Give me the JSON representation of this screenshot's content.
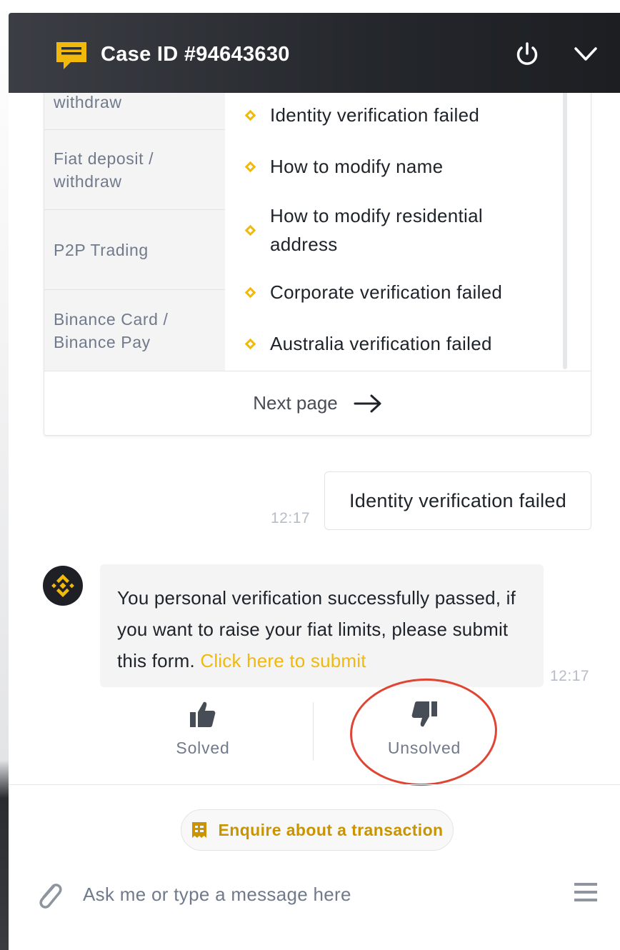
{
  "header": {
    "title": "Case ID #94643630",
    "icons": [
      "chat-icon",
      "power-icon",
      "chevron-down-icon"
    ]
  },
  "categories": [
    {
      "label": "withdraw"
    },
    {
      "label": "Fiat deposit / withdraw"
    },
    {
      "label": "P2P Trading"
    },
    {
      "label": "Binance Card / Binance Pay"
    }
  ],
  "questions": [
    {
      "label": "Identity verification failed"
    },
    {
      "label": "How to modify name"
    },
    {
      "label": "How to modify residential address"
    },
    {
      "label": "Corporate verification failed"
    },
    {
      "label": "Australia verification failed"
    }
  ],
  "next_page_label": "Next page",
  "messages": {
    "user": {
      "text": "Identity verification failed",
      "time": "12:17"
    },
    "bot": {
      "text": "You personal verification successfully passed, if you want to raise your fiat limits, please submit this form. ",
      "link_text": "Click here to submit",
      "time": "12:17"
    }
  },
  "feedback": {
    "solved_label": "Solved",
    "unsolved_label": "Unsolved"
  },
  "enquire_label": "Enquire about a transaction",
  "input": {
    "placeholder": "Ask me or type a message here",
    "value": ""
  },
  "colors": {
    "accent": "#F0B90B",
    "accent_text": "#C99400",
    "header_bg": "#24272C",
    "annotation": "#E04433"
  }
}
